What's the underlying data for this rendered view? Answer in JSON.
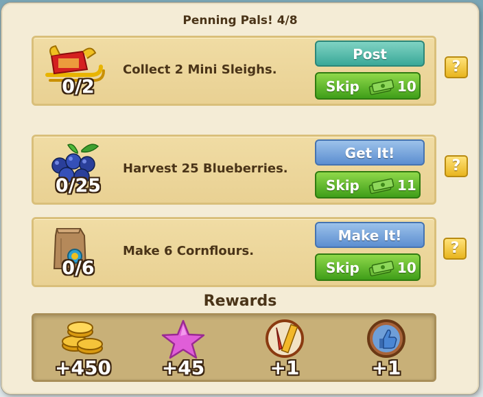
{
  "dialog": {
    "title": "Penning Pals! 4/8"
  },
  "tasks": [
    {
      "icon": "mini-sleigh-icon",
      "progress": "0/2",
      "text": "Collect 2 Mini Sleighs.",
      "action_label": "Post",
      "skip_label": "Skip",
      "skip_cost": "10"
    },
    {
      "icon": "blueberries-icon",
      "progress": "0/25",
      "text": "Harvest 25 Blueberries.",
      "action_label": "Get It!",
      "skip_label": "Skip",
      "skip_cost": "11"
    },
    {
      "icon": "cornflour-bag-icon",
      "progress": "0/6",
      "text": "Make 6 Cornflours.",
      "action_label": "Make It!",
      "skip_label": "Skip",
      "skip_cost": "10"
    }
  ],
  "help_label": "?",
  "rewards": {
    "title": "Rewards",
    "items": [
      {
        "icon": "gold-coins-icon",
        "value": "+450"
      },
      {
        "icon": "xp-star-icon",
        "value": "+45"
      },
      {
        "icon": "mastery-ruler-icon",
        "value": "+1"
      },
      {
        "icon": "thumbs-up-icon",
        "value": "+1"
      }
    ]
  },
  "colors": {
    "post_button": "#3aa898",
    "blue_button": "#5c8ed0",
    "skip_button": "#3f9e19",
    "help_button": "#e8b51e"
  }
}
